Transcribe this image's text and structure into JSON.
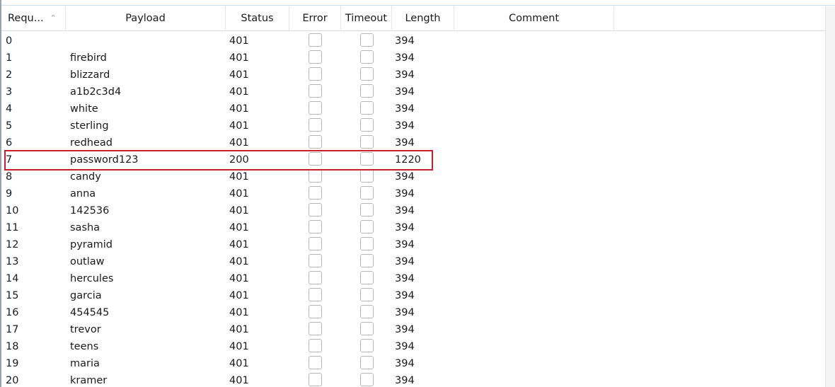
{
  "table": {
    "headers": {
      "request": "Requ...",
      "payload": "Payload",
      "status": "Status",
      "error": "Error",
      "timeout": "Timeout",
      "length": "Length",
      "comment": "Comment"
    },
    "rows": [
      {
        "request": "0",
        "payload": "",
        "status": "401",
        "length": "394"
      },
      {
        "request": "1",
        "payload": "firebird",
        "status": "401",
        "length": "394"
      },
      {
        "request": "2",
        "payload": "blizzard",
        "status": "401",
        "length": "394"
      },
      {
        "request": "3",
        "payload": "a1b2c3d4",
        "status": "401",
        "length": "394"
      },
      {
        "request": "4",
        "payload": "white",
        "status": "401",
        "length": "394"
      },
      {
        "request": "5",
        "payload": "sterling",
        "status": "401",
        "length": "394"
      },
      {
        "request": "6",
        "payload": "redhead",
        "status": "401",
        "length": "394"
      },
      {
        "request": "7",
        "payload": "password123",
        "status": "200",
        "length": "1220"
      },
      {
        "request": "8",
        "payload": "candy",
        "status": "401",
        "length": "394"
      },
      {
        "request": "9",
        "payload": "anna",
        "status": "401",
        "length": "394"
      },
      {
        "request": "10",
        "payload": "142536",
        "status": "401",
        "length": "394"
      },
      {
        "request": "11",
        "payload": "sasha",
        "status": "401",
        "length": "394"
      },
      {
        "request": "12",
        "payload": "pyramid",
        "status": "401",
        "length": "394"
      },
      {
        "request": "13",
        "payload": "outlaw",
        "status": "401",
        "length": "394"
      },
      {
        "request": "14",
        "payload": "hercules",
        "status": "401",
        "length": "394"
      },
      {
        "request": "15",
        "payload": "garcia",
        "status": "401",
        "length": "394"
      },
      {
        "request": "16",
        "payload": "454545",
        "status": "401",
        "length": "394"
      },
      {
        "request": "17",
        "payload": "trevor",
        "status": "401",
        "length": "394"
      },
      {
        "request": "18",
        "payload": "teens",
        "status": "401",
        "length": "394"
      },
      {
        "request": "19",
        "payload": "maria",
        "status": "401",
        "length": "394"
      },
      {
        "request": "20",
        "payload": "kramer",
        "status": "401",
        "length": "394"
      }
    ]
  },
  "icons": {
    "sort": "chevron-up-icon"
  },
  "colors": {
    "highlight": "#c7202b",
    "header_border": "#d9d9d9",
    "checkbox_border": "#b7b7b7"
  }
}
